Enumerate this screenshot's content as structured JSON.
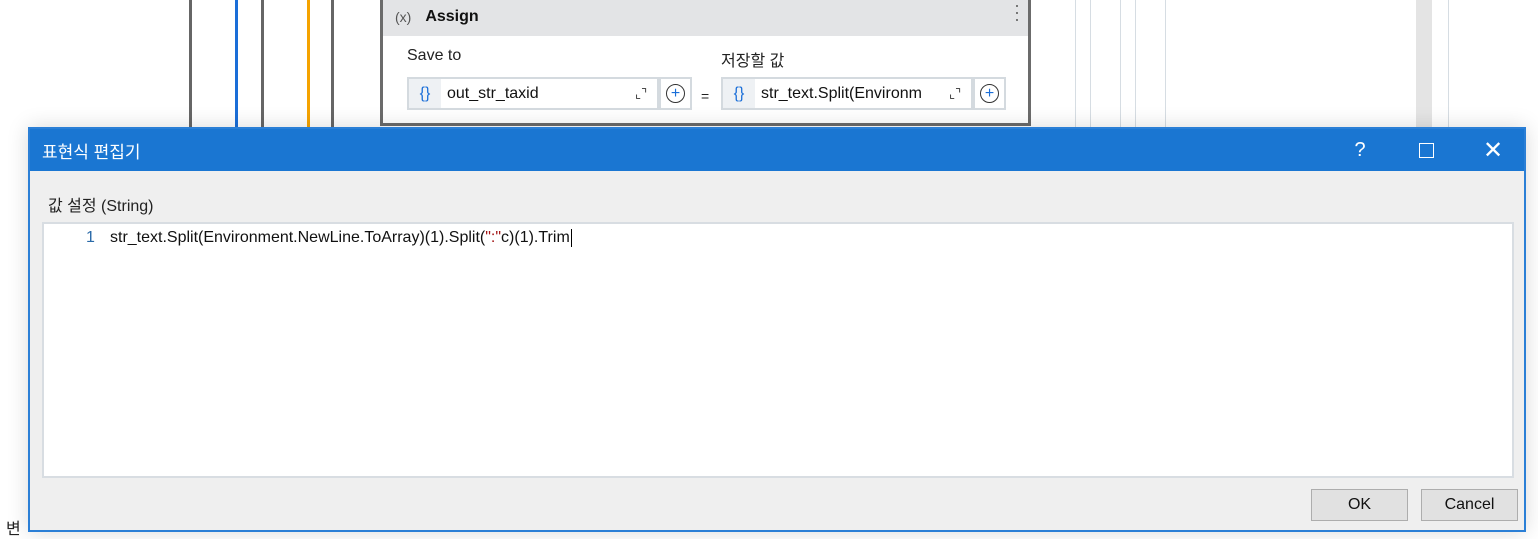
{
  "assign": {
    "icon": "variable-icon",
    "icon_text": "(x)",
    "title": "Assign",
    "save_to_label": "Save to",
    "save_to_value": "out_str_taxid",
    "value_label": "저장할 값",
    "value_value": "str_text.Split(Environm",
    "equals": "="
  },
  "dialog": {
    "title": "표현식 편집기",
    "help": "?",
    "subtitle": "값 설정 (String)",
    "line_number": "1",
    "code_pre": "str_text.Split(Environment.NewLine.ToArray)(1).Split(",
    "code_str": "\":\"",
    "code_post": "c)(1).Trim",
    "ok": "OK",
    "cancel": "Cancel"
  },
  "background_fragment": "변"
}
